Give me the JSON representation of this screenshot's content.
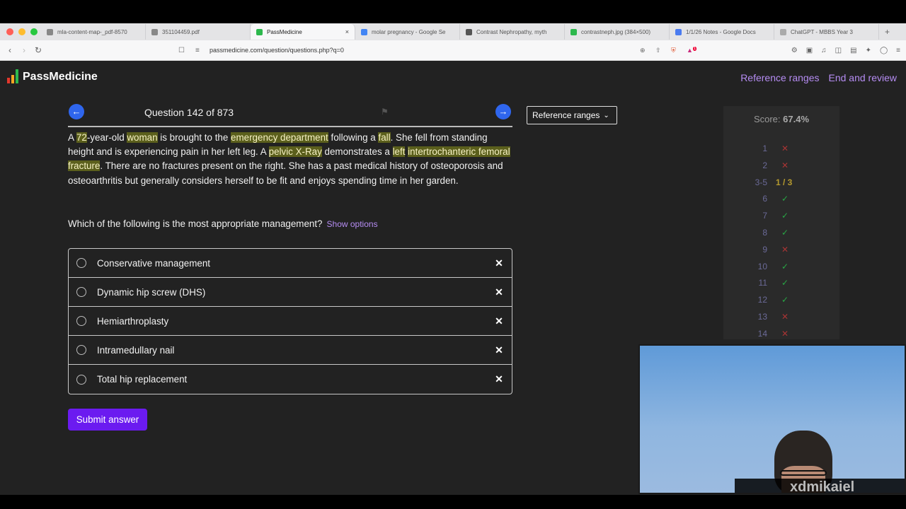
{
  "browser": {
    "tabs": [
      {
        "title": "mla-content-map-_pdf-8570",
        "active": false,
        "icon": "globe-icon"
      },
      {
        "title": "351104459.pdf",
        "active": false,
        "icon": "globe-icon"
      },
      {
        "title": "PassMedicine",
        "active": true,
        "icon": "passmedicine-icon"
      },
      {
        "title": "molar pregnancy - Google Se",
        "active": false,
        "icon": "google-icon"
      },
      {
        "title": "Contrast Nephropathy, myth",
        "active": false,
        "icon": "article-icon"
      },
      {
        "title": "contrastneph.jpg (384×500)",
        "active": false,
        "icon": "image-icon"
      },
      {
        "title": "1/1/26 Notes - Google Docs",
        "active": false,
        "icon": "docs-icon"
      },
      {
        "title": "ChatGPT - MBBS Year 3",
        "active": false,
        "icon": "chatgpt-icon"
      }
    ],
    "url": "passmedicine.com/question/questions.php?q=0",
    "brave_badge": "1"
  },
  "site": {
    "brand": "PassMedicine",
    "nav": {
      "reference_ranges": "Reference ranges",
      "end_review": "End and review"
    }
  },
  "question": {
    "counter": "Question 142 of 873",
    "stem": [
      {
        "t": "A "
      },
      {
        "t": "72",
        "h": true
      },
      {
        "t": "-year-old "
      },
      {
        "t": "woman",
        "h": true
      },
      {
        "t": " is brought to the "
      },
      {
        "t": "emergency department",
        "h": true
      },
      {
        "t": " following a "
      },
      {
        "t": "fall",
        "h": true
      },
      {
        "t": ". She fell from standing height and is experiencing pain in her left leg. A "
      },
      {
        "t": "pelvic X-Ray",
        "h": true
      },
      {
        "t": " demonstrates a "
      },
      {
        "t": "left",
        "h": true
      },
      {
        "t": " "
      },
      {
        "t": "intertrochanteric femoral fracture",
        "h": true
      },
      {
        "t": ". There are no fractures present on the right. She has a past medical history of osteoporosis and osteoarthritis but generally considers herself to be fit and enjoys spending time in her garden."
      }
    ],
    "prompt": "Which of the following is the most appropriate management?",
    "show_options": "Show options",
    "options": [
      "Conservative management",
      "Dynamic hip screw (DHS)",
      "Hemiarthroplasty",
      "Intramedullary nail",
      "Total hip replacement"
    ],
    "submit": "Submit answer"
  },
  "reference_dropdown": {
    "label": "Reference ranges"
  },
  "scoreboard": {
    "score_label": "Score:",
    "score_value": "67.4%",
    "rows": [
      {
        "n": "1",
        "r": "cross"
      },
      {
        "n": "2",
        "r": "cross"
      },
      {
        "n": "3-5",
        "r": "partial",
        "text": "1 / 3"
      },
      {
        "n": "6",
        "r": "tick"
      },
      {
        "n": "7",
        "r": "tick"
      },
      {
        "n": "8",
        "r": "tick"
      },
      {
        "n": "9",
        "r": "cross"
      },
      {
        "n": "10",
        "r": "tick"
      },
      {
        "n": "11",
        "r": "tick"
      },
      {
        "n": "12",
        "r": "tick"
      },
      {
        "n": "13",
        "r": "cross"
      },
      {
        "n": "14",
        "r": "cross"
      }
    ]
  },
  "webcam": {
    "watermark": "xdmikaiel"
  },
  "colors": {
    "accent": "#6b1bf0",
    "link": "#b58cf2",
    "highlight": "#5b5f1c",
    "tick": "#28a745",
    "cross": "#a83434"
  }
}
